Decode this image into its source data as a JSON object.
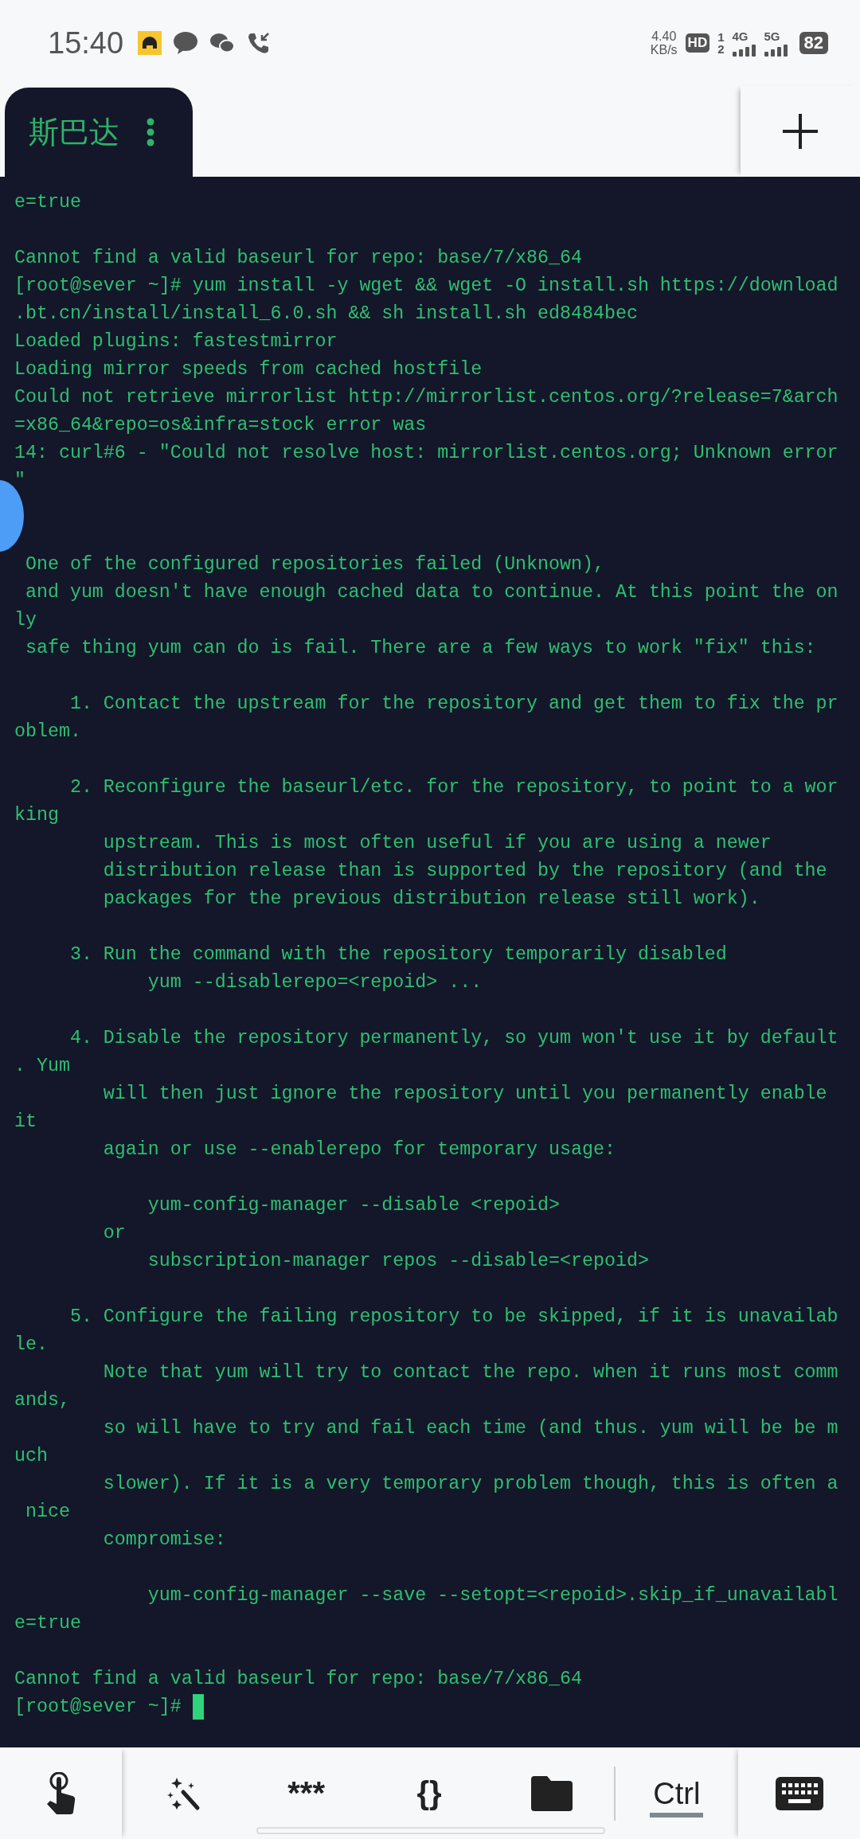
{
  "status_bar": {
    "time": "15:40",
    "net_speed": "4.40",
    "net_speed_unit": "KB/s",
    "hd": "HD",
    "sim_slots": "1",
    "sim_slots_2": "2",
    "network_1": "4G",
    "network_2": "5G",
    "battery": "82"
  },
  "tabs": [
    {
      "label": "斯巴达",
      "selected": true
    }
  ],
  "terminal": {
    "lines": [
      {
        "text": "e=true"
      },
      {
        "kind": "blank"
      },
      {
        "text": "Cannot find a valid baseurl for repo: base/7/x86_64"
      },
      {
        "text": "[root@sever ~]# yum install -y wget && wget -O install.sh https://download"
      },
      {
        "text": ".bt.cn/install/install_6.0.sh && sh install.sh ed8484bec"
      },
      {
        "text": "Loaded plugins: fastestmirror"
      },
      {
        "text": "Loading mirror speeds from cached hostfile"
      },
      {
        "text": "Could not retrieve mirrorlist http://mirrorlist.centos.org/?release=7&arch"
      },
      {
        "text": "=x86_64&repo=os&infra=stock error was"
      },
      {
        "text": "14: curl#6 - \"Could not resolve host: mirrorlist.centos.org; Unknown error"
      },
      {
        "text": "\""
      },
      {
        "kind": "blank"
      },
      {
        "kind": "blank"
      },
      {
        "text": " One of the configured repositories failed (Unknown),"
      },
      {
        "text": " and yum doesn't have enough cached data to continue. At this point the on"
      },
      {
        "text": "ly"
      },
      {
        "text": " safe thing yum can do is fail. There are a few ways to work \"fix\" this:"
      },
      {
        "kind": "blank"
      },
      {
        "text": "     1. Contact the upstream for the repository and get them to fix the pr"
      },
      {
        "text": "oblem."
      },
      {
        "kind": "blank"
      },
      {
        "text": "     2. Reconfigure the baseurl/etc. for the repository, to point to a wor"
      },
      {
        "text": "king"
      },
      {
        "text": "        upstream. This is most often useful if you are using a newer"
      },
      {
        "text": "        distribution release than is supported by the repository (and the"
      },
      {
        "text": "        packages for the previous distribution release still work)."
      },
      {
        "kind": "blank"
      },
      {
        "text": "     3. Run the command with the repository temporarily disabled"
      },
      {
        "text": "            yum --disablerepo=<repoid> ..."
      },
      {
        "kind": "blank"
      },
      {
        "text": "     4. Disable the repository permanently, so yum won't use it by default"
      },
      {
        "text": ". Yum"
      },
      {
        "text": "        will then just ignore the repository until you permanently enable"
      },
      {
        "text": "it"
      },
      {
        "text": "        again or use --enablerepo for temporary usage:"
      },
      {
        "kind": "blank"
      },
      {
        "text": "            yum-config-manager --disable <repoid>"
      },
      {
        "text": "        or"
      },
      {
        "text": "            subscription-manager repos --disable=<repoid>"
      },
      {
        "kind": "blank"
      },
      {
        "text": "     5. Configure the failing repository to be skipped, if it is unavailab"
      },
      {
        "text": "le."
      },
      {
        "text": "        Note that yum will try to contact the repo. when it runs most comm"
      },
      {
        "text": "ands,"
      },
      {
        "text": "        so will have to try and fail each time (and thus. yum will be be m"
      },
      {
        "text": "uch"
      },
      {
        "text": "        slower). If it is a very temporary problem though, this is often a"
      },
      {
        "text": " nice"
      },
      {
        "text": "        compromise:"
      },
      {
        "kind": "blank"
      },
      {
        "text": "            yum-config-manager --save --setopt=<repoid>.skip_if_unavailabl"
      },
      {
        "text": "e=true"
      },
      {
        "kind": "blank"
      },
      {
        "text": "Cannot find a valid baseurl for repo: base/7/x86_64"
      },
      {
        "text": "[root@sever ~]# ",
        "kind": "prompt"
      }
    ]
  },
  "toolbar": {
    "keys": [
      {
        "kind": "touch"
      },
      {
        "kind": "magic"
      },
      {
        "kind": "text",
        "label": "***"
      },
      {
        "kind": "text",
        "label": "{}"
      },
      {
        "kind": "folder"
      },
      {
        "kind": "ctrl",
        "label": "Ctrl"
      },
      {
        "kind": "keyboard"
      }
    ]
  }
}
